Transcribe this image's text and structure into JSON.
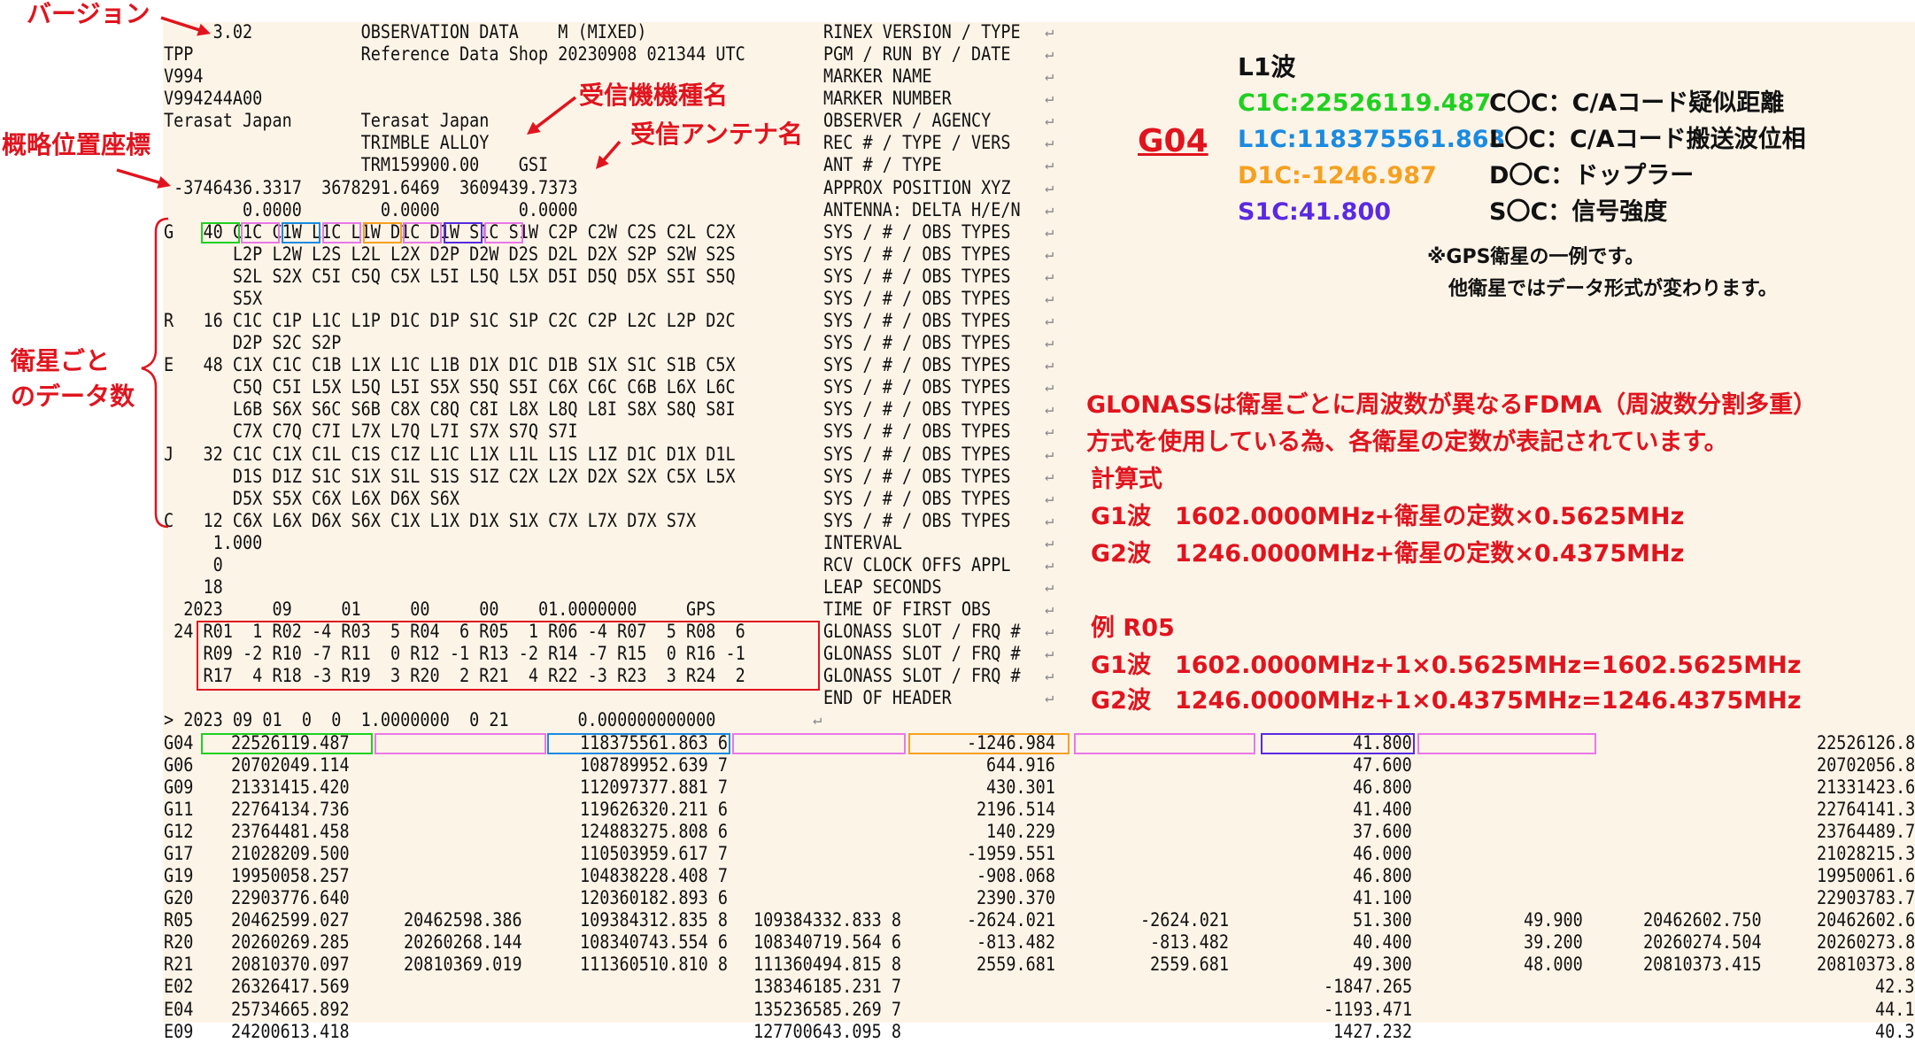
{
  "header_rows": [
    {
      "text": "     3.02           OBSERVATION DATA    M (MIXED)",
      "label": "RINEX VERSION / TYPE"
    },
    {
      "text": "TPP                 Reference Data Shop 20230908 021344 UTC",
      "label": "PGM / RUN BY / DATE"
    },
    {
      "text": "V994",
      "label": "MARKER NAME"
    },
    {
      "text": "V994244A00",
      "label": "MARKER NUMBER"
    },
    {
      "text": "Terasat Japan       Terasat Japan",
      "label": "OBSERVER / AGENCY"
    },
    {
      "text": "                    TRIMBLE ALLOY",
      "label": "REC # / TYPE / VERS"
    },
    {
      "text": "                    TRM159900.00    GSI",
      "label": "ANT # / TYPE"
    },
    {
      "text": " -3746436.3317  3678291.6469  3609439.7373",
      "label": "APPROX POSITION XYZ"
    },
    {
      "text": "        0.0000        0.0000        0.0000",
      "label": "ANTENNA: DELTA H/E/N"
    },
    {
      "text": "G   40 C1C C1W L1C L1W D1C D1W S1C S1W C2P C2W C2S C2L C2X",
      "label": "SYS / # / OBS TYPES"
    },
    {
      "text": "       L2P L2W L2S L2L L2X D2P D2W D2S D2L D2X S2P S2W S2S",
      "label": "SYS / # / OBS TYPES"
    },
    {
      "text": "       S2L S2X C5I C5Q C5X L5I L5Q L5X D5I D5Q D5X S5I S5Q",
      "label": "SYS / # / OBS TYPES"
    },
    {
      "text": "       S5X",
      "label": "SYS / # / OBS TYPES"
    },
    {
      "text": "R   16 C1C C1P L1C L1P D1C D1P S1C S1P C2C C2P L2C L2P D2C",
      "label": "SYS / # / OBS TYPES"
    },
    {
      "text": "       D2P S2C S2P",
      "label": "SYS / # / OBS TYPES"
    },
    {
      "text": "E   48 C1X C1C C1B L1X L1C L1B D1X D1C D1B S1X S1C S1B C5X",
      "label": "SYS / # / OBS TYPES"
    },
    {
      "text": "       C5Q C5I L5X L5Q L5I S5X S5Q S5I C6X C6C C6B L6X L6C",
      "label": "SYS / # / OBS TYPES"
    },
    {
      "text": "       L6B S6X S6C S6B C8X C8Q C8I L8X L8Q L8I S8X S8Q S8I",
      "label": "SYS / # / OBS TYPES"
    },
    {
      "text": "       C7X C7Q C7I L7X L7Q L7I S7X S7Q S7I",
      "label": "SYS / # / OBS TYPES"
    },
    {
      "text": "J   32 C1C C1X C1L C1S C1Z L1C L1X L1L L1S L1Z D1C D1X D1L",
      "label": "SYS / # / OBS TYPES"
    },
    {
      "text": "       D1S D1Z S1C S1X S1L S1S S1Z C2X L2X D2X S2X C5X L5X",
      "label": "SYS / # / OBS TYPES"
    },
    {
      "text": "       D5X S5X C6X L6X D6X S6X",
      "label": "SYS / # / OBS TYPES"
    },
    {
      "text": "C   12 C6X L6X D6X S6X C1X L1X D1X S1X C7X L7X D7X S7X",
      "label": "SYS / # / OBS TYPES"
    },
    {
      "text": "     1.000",
      "label": "INTERVAL"
    },
    {
      "text": "     0",
      "label": "RCV CLOCK OFFS APPL"
    },
    {
      "text": "    18",
      "label": "LEAP SECONDS"
    },
    {
      "text": "  2023     09     01     00     00    01.0000000     GPS",
      "label": "TIME OF FIRST OBS"
    },
    {
      "text": " 24 R01  1 R02 -4 R03  5 R04  6 R05  1 R06 -4 R07  5 R08  6",
      "label": "GLONASS SLOT / FRQ #"
    },
    {
      "text": "    R09 -2 R10 -7 R11  0 R12 -1 R13 -2 R14 -7 R15  0 R16 -1",
      "label": "GLONASS SLOT / FRQ #"
    },
    {
      "text": "    R17  4 R18 -3 R19  3 R20  2 R21  4 R22 -3 R23  3 R24  2",
      "label": "GLONASS SLOT / FRQ #"
    },
    {
      "text": "",
      "label": "END OF HEADER"
    }
  ],
  "epoch_line": "> 2023 09 01  0  0  1.0000000  0 21       0.000000000000",
  "obs_rows": [
    [
      "G04",
      "22526119.487",
      "",
      "118375561.863 6",
      "",
      "-1246.984",
      "",
      "41.800",
      "",
      "",
      "22526126.8"
    ],
    [
      "G06",
      "20702049.114",
      "",
      "108789952.639 7",
      "",
      "644.916",
      "",
      "47.600",
      "",
      "",
      "20702056.8"
    ],
    [
      "G09",
      "21331415.420",
      "",
      "112097377.881 7",
      "",
      "430.301",
      "",
      "46.800",
      "",
      "",
      "21331423.6"
    ],
    [
      "G11",
      "22764134.736",
      "",
      "119626320.211 6",
      "",
      "2196.514",
      "",
      "41.400",
      "",
      "",
      "22764141.3"
    ],
    [
      "G12",
      "23764481.458",
      "",
      "124883275.808 6",
      "",
      "140.229",
      "",
      "37.600",
      "",
      "",
      "23764489.7"
    ],
    [
      "G17",
      "21028209.500",
      "",
      "110503959.617 7",
      "",
      "-1959.551",
      "",
      "46.000",
      "",
      "",
      "21028215.3"
    ],
    [
      "G19",
      "19950058.257",
      "",
      "104838228.408 7",
      "",
      "-908.068",
      "",
      "46.800",
      "",
      "",
      "19950061.6"
    ],
    [
      "G20",
      "22903776.640",
      "",
      "120360182.893 6",
      "",
      "2390.370",
      "",
      "41.100",
      "",
      "",
      "22903783.7"
    ],
    [
      "R05",
      "20462599.027",
      "20462598.386",
      "109384312.835 8",
      "109384332.833 8",
      "-2624.021",
      "-2624.021",
      "51.300",
      "49.900",
      "20462602.750",
      "20462602.6"
    ],
    [
      "R20",
      "20260269.285",
      "20260268.144",
      "108340743.554 6",
      "108340719.564 6",
      "-813.482",
      "-813.482",
      "40.400",
      "39.200",
      "20260274.504",
      "20260273.8"
    ],
    [
      "R21",
      "20810370.097",
      "20810369.019",
      "111360510.810 8",
      "111360494.815 8",
      "2559.681",
      "2559.681",
      "49.300",
      "48.000",
      "20810373.415",
      "20810373.8"
    ],
    [
      "E02",
      "26326417.569",
      "",
      "",
      "138346185.231 7",
      "",
      "",
      "-1847.265",
      "",
      "",
      "42.3"
    ],
    [
      "E04",
      "25734665.892",
      "",
      "",
      "135236585.269 7",
      "",
      "",
      "-1193.471",
      "",
      "",
      "44.1"
    ],
    [
      "E09",
      "24200613.418",
      "",
      "",
      "127700643.095 8",
      "",
      "",
      "1427.232",
      "",
      "",
      "40.3"
    ]
  ],
  "annotations": {
    "version": "バージョン",
    "receiver_type": "受信機機種名",
    "antenna_name": "受信アンテナ名",
    "approx_position": "概略位置座標",
    "obs_count_1": "衛星ごと",
    "obs_count_2": "のデータ数"
  },
  "legend": {
    "title": "L1波",
    "sat": "G04",
    "items": [
      {
        "value": "C1C:22526119.487",
        "desc": "C〇C：C/Aコード疑似距離",
        "color": "#20d020"
      },
      {
        "value": "L1C:118375561.863",
        "desc": "L〇C：C/Aコード搬送波位相",
        "color": "#1a8ae0"
      },
      {
        "value": "D1C:-1246.987",
        "desc": "D〇C：ドップラー",
        "color": "#f5a020"
      },
      {
        "value": "S1C:41.800",
        "desc": "S〇C：信号強度",
        "color": "#5a2ae0"
      }
    ],
    "note1": "※GPS衛星の一例です。",
    "note2": "他衛星ではデータ形式が変わります。"
  },
  "glonass": {
    "line1": "GLONASSは衛星ごとに周波数が異なるFDMA（周波数分割多重）",
    "line2": "方式を使用している為、各衛星の定数が表記されています。",
    "formula_title": "計算式",
    "g1": "G1波　1602.0000MHz+衛星の定数×0.5625MHz",
    "g2": "G2波　1246.0000MHz+衛星の定数×0.4375MHz",
    "example_title": "例 R05",
    "ex_g1": "G1波　1602.0000MHz+1×0.5625MHz=1602.5625MHz",
    "ex_g2": "G2波　1246.0000MHz+1×0.4375MHz=1246.4375MHz"
  },
  "colors": {
    "annotation_red": "#e0141e",
    "c1c_green": "#20d020",
    "l1c_blue": "#1a8ae0",
    "d1c_orange": "#f5a020",
    "s1c_purple": "#5a2ae0",
    "w_pink": "#e878e8",
    "background": "#fdf4e8"
  }
}
